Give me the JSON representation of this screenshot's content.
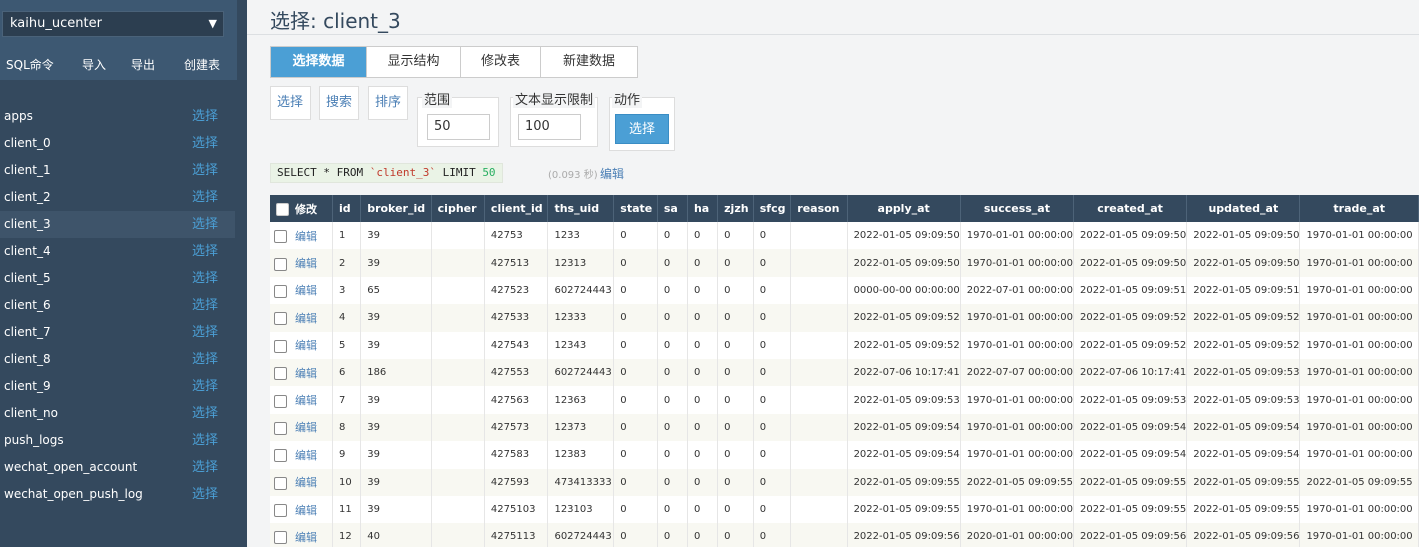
{
  "sidebar": {
    "database": "kaihu_ucenter",
    "actions": [
      "SQL命令",
      "导入",
      "导出",
      "创建表"
    ],
    "select_label": "选择",
    "tables": [
      "apps",
      "client_0",
      "client_1",
      "client_2",
      "client_3",
      "client_4",
      "client_5",
      "client_6",
      "client_7",
      "client_8",
      "client_9",
      "client_no",
      "push_logs",
      "wechat_open_account",
      "wechat_open_push_log"
    ],
    "active_table": "client_3"
  },
  "main": {
    "title": "选择: client_3",
    "tabs": [
      "选择数据",
      "显示结构",
      "修改表",
      "新建数据"
    ],
    "active_tab": "选择数据",
    "options": {
      "select": "选择",
      "search": "搜索",
      "sort": "排序",
      "range_label": "范围",
      "range_value": "50",
      "text_limit_label": "文本显示限制",
      "text_limit_value": "100",
      "action_label": "动作",
      "action_button": "选择"
    },
    "sql": {
      "prefix": "SELECT * FROM ",
      "table": "`client_3`",
      "limit_kw": " LIMIT ",
      "limit": "50",
      "time": "(0.093 秒)",
      "edit": "编辑"
    }
  },
  "grid": {
    "edit_header": "修改",
    "edit_label": "编辑",
    "columns": [
      "id",
      "broker_id",
      "cipher",
      "client_id",
      "ths_uid",
      "state",
      "sa",
      "ha",
      "zjzh",
      "sfcg",
      "reason",
      "apply_at",
      "success_at",
      "created_at",
      "updated_at",
      "trade_at"
    ],
    "rows": [
      [
        "1",
        "39",
        "",
        "42753",
        "1233",
        "0",
        "0",
        "0",
        "0",
        "0",
        "",
        "2022-01-05 09:09:50",
        "1970-01-01 00:00:00",
        "2022-01-05 09:09:50",
        "2022-01-05 09:09:50",
        "1970-01-01 00:00:00"
      ],
      [
        "2",
        "39",
        "",
        "427513",
        "12313",
        "0",
        "0",
        "0",
        "0",
        "0",
        "",
        "2022-01-05 09:09:50",
        "1970-01-01 00:00:00",
        "2022-01-05 09:09:50",
        "2022-01-05 09:09:50",
        "1970-01-01 00:00:00"
      ],
      [
        "3",
        "65",
        "",
        "427523",
        "602724443",
        "0",
        "0",
        "0",
        "0",
        "0",
        "",
        "0000-00-00 00:00:00",
        "2022-07-01 00:00:00",
        "2022-01-05 09:09:51",
        "2022-01-05 09:09:51",
        "1970-01-01 00:00:00"
      ],
      [
        "4",
        "39",
        "",
        "427533",
        "12333",
        "0",
        "0",
        "0",
        "0",
        "0",
        "",
        "2022-01-05 09:09:52",
        "1970-01-01 00:00:00",
        "2022-01-05 09:09:52",
        "2022-01-05 09:09:52",
        "1970-01-01 00:00:00"
      ],
      [
        "5",
        "39",
        "",
        "427543",
        "12343",
        "0",
        "0",
        "0",
        "0",
        "0",
        "",
        "2022-01-05 09:09:52",
        "1970-01-01 00:00:00",
        "2022-01-05 09:09:52",
        "2022-01-05 09:09:52",
        "1970-01-01 00:00:00"
      ],
      [
        "6",
        "186",
        "",
        "427553",
        "602724443",
        "0",
        "0",
        "0",
        "0",
        "0",
        "",
        "2022-07-06 10:17:41",
        "2022-07-07 00:00:00",
        "2022-07-06 10:17:41",
        "2022-01-05 09:09:53",
        "1970-01-01 00:00:00"
      ],
      [
        "7",
        "39",
        "",
        "427563",
        "12363",
        "0",
        "0",
        "0",
        "0",
        "0",
        "",
        "2022-01-05 09:09:53",
        "1970-01-01 00:00:00",
        "2022-01-05 09:09:53",
        "2022-01-05 09:09:53",
        "1970-01-01 00:00:00"
      ],
      [
        "8",
        "39",
        "",
        "427573",
        "12373",
        "0",
        "0",
        "0",
        "0",
        "0",
        "",
        "2022-01-05 09:09:54",
        "1970-01-01 00:00:00",
        "2022-01-05 09:09:54",
        "2022-01-05 09:09:54",
        "1970-01-01 00:00:00"
      ],
      [
        "9",
        "39",
        "",
        "427583",
        "12383",
        "0",
        "0",
        "0",
        "0",
        "0",
        "",
        "2022-01-05 09:09:54",
        "1970-01-01 00:00:00",
        "2022-01-05 09:09:54",
        "2022-01-05 09:09:54",
        "1970-01-01 00:00:00"
      ],
      [
        "10",
        "39",
        "",
        "427593",
        "473413333",
        "0",
        "0",
        "0",
        "0",
        "0",
        "",
        "2022-01-05 09:09:55",
        "2022-01-05 09:09:55",
        "2022-01-05 09:09:55",
        "2022-01-05 09:09:55",
        "2022-01-05 09:09:55"
      ],
      [
        "11",
        "39",
        "",
        "4275103",
        "123103",
        "0",
        "0",
        "0",
        "0",
        "0",
        "",
        "2022-01-05 09:09:55",
        "1970-01-01 00:00:00",
        "2022-01-05 09:09:55",
        "2022-01-05 09:09:55",
        "1970-01-01 00:00:00"
      ],
      [
        "12",
        "40",
        "",
        "4275113",
        "602724443",
        "0",
        "0",
        "0",
        "0",
        "0",
        "",
        "2022-01-05 09:09:56",
        "2020-01-01 00:00:00",
        "2022-01-05 09:09:56",
        "2022-01-05 09:09:56",
        "1970-01-01 00:00:00"
      ]
    ]
  }
}
